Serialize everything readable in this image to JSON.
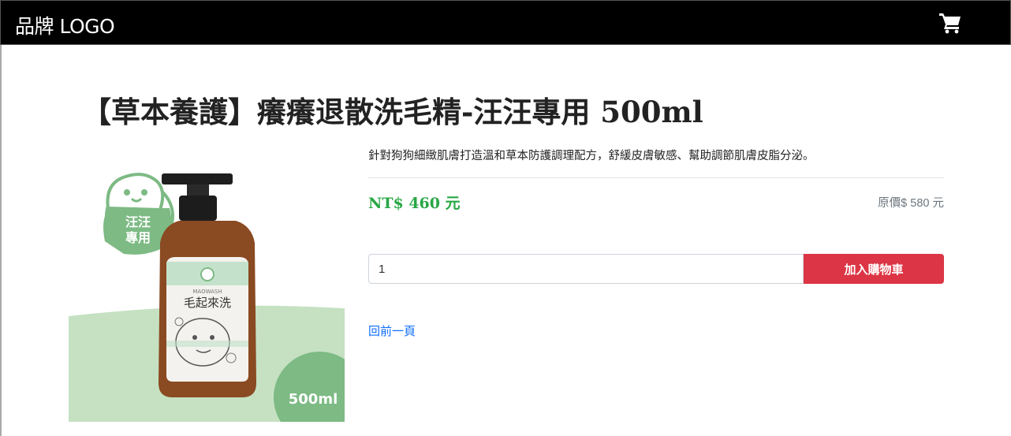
{
  "navbar": {
    "brand": "品牌 LOGO",
    "cart_icon": "shopping-cart-icon"
  },
  "product": {
    "title": "【草本養護】癢癢退散洗毛精-汪汪專用 500ml",
    "description": "針對狗狗細緻肌膚打造溫和草本防護調理配方，舒緩皮膚敏感、幫助調節肌膚皮脂分泌。",
    "price": "NT$ 460 元",
    "original_price": "原價$ 580 元",
    "image": {
      "badge_line1": "汪汪",
      "badge_line2": "專用",
      "bottle_brand": "MAOWASH",
      "bottle_name": "毛起來洗",
      "volume": "500ml"
    }
  },
  "cart_form": {
    "quantity": "1",
    "add_button": "加入購物車"
  },
  "back_link": "回前一頁",
  "colors": {
    "navbar": "#000000",
    "price": "#28a745",
    "add_button": "#dc3545",
    "link": "#0d6efd",
    "image_green": "#7dba84",
    "image_light_green": "#c5e1c2",
    "bottle": "#8a4a22"
  }
}
